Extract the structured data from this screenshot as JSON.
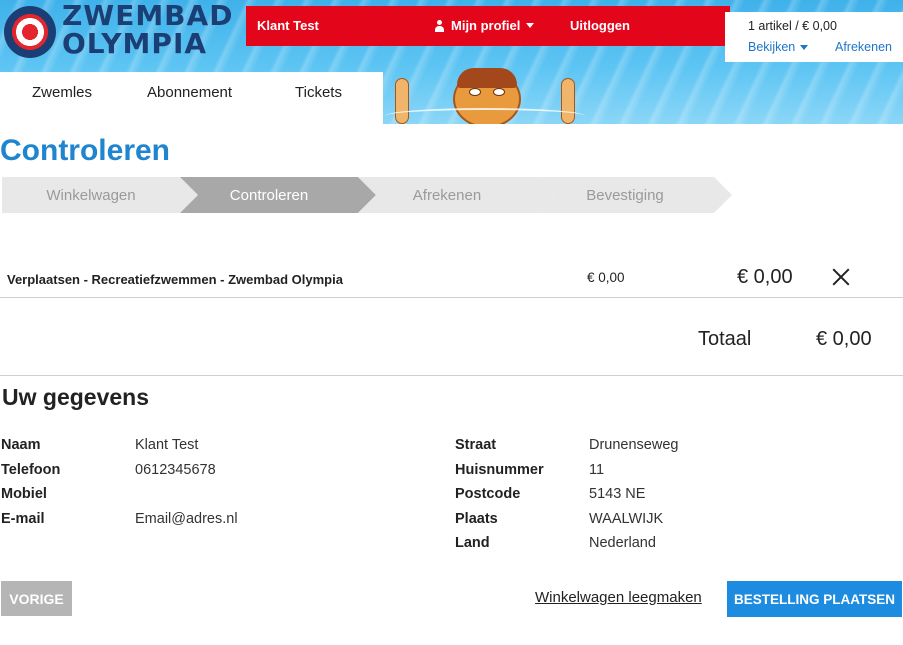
{
  "brand": {
    "line1": "ZWEMBAD",
    "line2": "OLYMPIA"
  },
  "topbar": {
    "user_name": "Klant Test",
    "profile_label": "Mijn profiel",
    "logout_label": "Uitloggen"
  },
  "cart": {
    "summary": "1 artikel / € 0,00",
    "view_label": "Bekijken",
    "checkout_label": "Afrekenen"
  },
  "nav": {
    "items": [
      {
        "label": "Zwemles"
      },
      {
        "label": "Abonnement"
      },
      {
        "label": "Tickets"
      }
    ]
  },
  "page": {
    "title": "Controleren"
  },
  "steps": [
    {
      "label": "Winkelwagen",
      "state": "done"
    },
    {
      "label": "Controleren",
      "state": "active"
    },
    {
      "label": "Afrekenen",
      "state": "todo"
    },
    {
      "label": "Bevestiging",
      "state": "todo"
    }
  ],
  "line_items": [
    {
      "name": "Verplaatsen - Recreatiefzwemmen - Zwembad Olympia",
      "unit_price": "€ 0,00",
      "total": "€ 0,00"
    }
  ],
  "totals": {
    "label": "Totaal",
    "value": "€ 0,00"
  },
  "details": {
    "title": "Uw gegevens",
    "left": [
      {
        "label": "Naam",
        "value": "Klant Test"
      },
      {
        "label": "Telefoon",
        "value": "0612345678"
      },
      {
        "label": "Mobiel",
        "value": ""
      },
      {
        "label": "E-mail",
        "value": "Email@adres.nl"
      }
    ],
    "right": [
      {
        "label": "Straat",
        "value": "Drunenseweg"
      },
      {
        "label": "Huisnummer",
        "value": "11"
      },
      {
        "label": "Postcode",
        "value": "5143 NE"
      },
      {
        "label": "Plaats",
        "value": "WAALWIJK"
      },
      {
        "label": "Land",
        "value": "Nederland"
      }
    ]
  },
  "actions": {
    "previous_label": "VORIGE",
    "empty_cart_label": "Winkelwagen leegmaken",
    "place_order_label": "BESTELLING PLAATSEN"
  },
  "colors": {
    "brand_red": "#e3061b",
    "brand_blue": "#1f85cf",
    "primary_button": "#1d8ce0",
    "secondary_button": "#b5b5b5"
  }
}
